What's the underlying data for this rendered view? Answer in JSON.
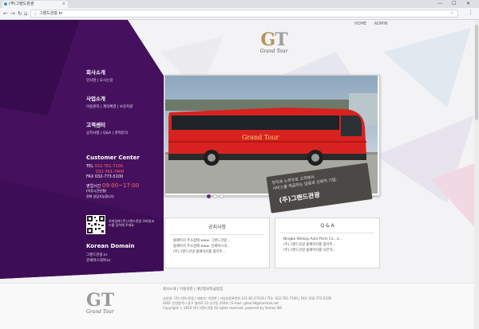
{
  "browser": {
    "tab_title": "(주)그랜드관광",
    "tab_close": "×",
    "minimize": "—",
    "maximize": "☐",
    "close": "✕",
    "back": "←",
    "forward": "→",
    "reload": "↻",
    "home": "⌂",
    "url": "그랜드관광.kr",
    "star": "☆",
    "menu": "⋮"
  },
  "topnav": {
    "home": "HOME",
    "admin": "ADMIN"
  },
  "logo": {
    "mark_g": "G",
    "mark_t": "T",
    "subtitle": "Grand Tour"
  },
  "sidebar": {
    "sections": [
      {
        "title": "회사소개",
        "links": "인사말 | 오시는길"
      },
      {
        "title": "사업소개",
        "links": "이용원칙 | 계약체결 | 보유차량"
      },
      {
        "title": "고객센터",
        "links": "공지사항 | Q&A | 견적문의"
      }
    ],
    "customer_center": {
      "title": "Customer Center",
      "tel_label": "TEL",
      "tel1": "032-761-7100",
      "tel2": "032-761-7400",
      "fax": "FAX 032-773-5100",
      "hours_label": "영업시간",
      "hours": "09:00~17:00",
      "note1": "(이후시간연결)",
      "note2": "전화 상담가능합니다."
    },
    "qr_text": "모바일에 (주)그랜드관광 모바일코드를 입력해 주세요",
    "korean_domain": {
      "title": "Korean Domain",
      "line1": "그랜드관광.kr",
      "line2": "관세버스대여.kr"
    }
  },
  "hero": {
    "bus_text": "Grand Tour",
    "slogan_line1": "정직과 노하우로 고객께서",
    "slogan_line2": "서비스를 제공하는 믿음과 신뢰의 기업.",
    "slogan_company": "(주)그랜드관광"
  },
  "notice": {
    "title": "공지사항",
    "items": [
      "홈페이지 주소창에 www. 그랜드관광...",
      "홈페이지 주소창에 www. 전세버스대...",
      "(주)그랜드관광 홈페이지를 찾아주..."
    ]
  },
  "qna": {
    "title": "Q & A",
    "items": [
      "Ningbo Winkay Auto Parts Co., Li...",
      "(주)그랜드관광 홈페이지를 찾아주...",
      "(주)그랜드관광 홈페이지를 오픈하..."
    ]
  },
  "footer": {
    "links": "회사소개  |  이용약관  |  개인정보취급방침",
    "addr1": "상호명: (주)그랜드관광 | 대표자: 박정현 | 사업자등록번호:121-81-27019 | TEL: 032-761-7100 | FAX: 032-773-5100",
    "addr2": "ADD: 인천광역시 중구 월미로 13 상가동 204호 | E-mail: gtour18@hanmail.net",
    "copyright": "Copyright ⓒ 2016 (주)그랜드관광 All rights reserved. powered by Somso INC."
  },
  "colors": {
    "purple": "#45115e",
    "red": "#ff6a6a",
    "gold": "#b59558"
  }
}
